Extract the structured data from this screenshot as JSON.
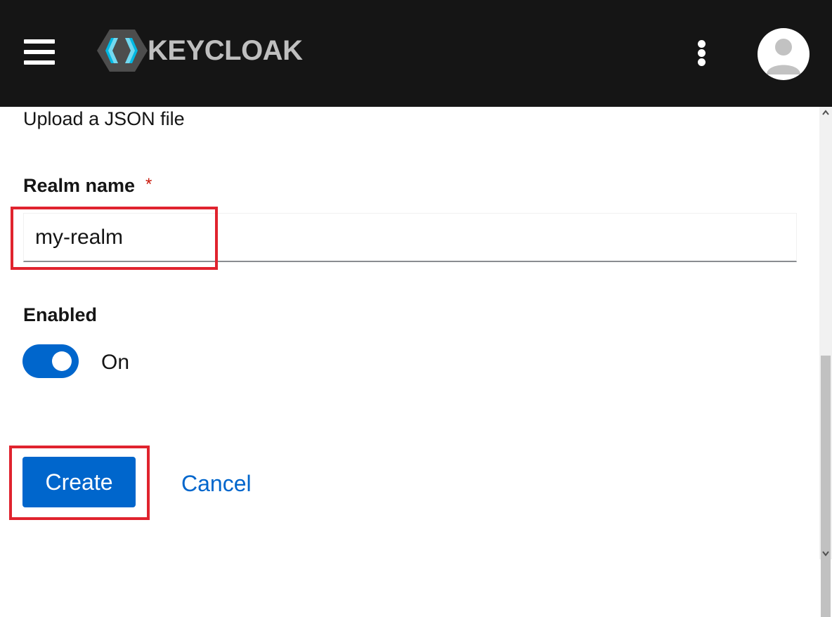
{
  "header": {
    "brand": "KEYCLOAK",
    "menu_icon": "hamburger-menu-icon",
    "kebab_icon": "kebab-menu-icon",
    "avatar_icon": "user-avatar-icon",
    "background_color": "#151515"
  },
  "form": {
    "upload_text": "Upload a JSON file",
    "realm_name_label": "Realm name",
    "required_marker": "*",
    "realm_name_value": "my-realm",
    "enabled_label": "Enabled",
    "enabled_state": "On",
    "enabled": true,
    "create_label": "Create",
    "cancel_label": "Cancel"
  },
  "colors": {
    "primary": "#0066cc",
    "highlight": "#e0232e",
    "required": "#c9190b"
  }
}
